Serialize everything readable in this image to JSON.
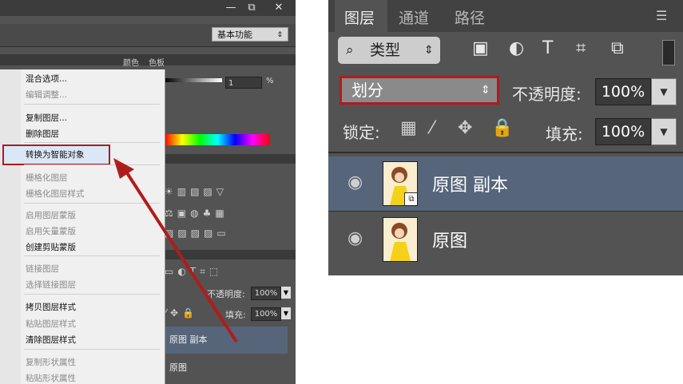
{
  "left_window": {
    "controls": {
      "minimize": "—",
      "maximize": "⧉",
      "close": "✕"
    },
    "workspace": {
      "label": "基本功能"
    },
    "panel_tabs": {
      "color": "颜色",
      "swatches": "色板"
    },
    "opacity_value": "1",
    "percent": "%",
    "layers_panel": {
      "opacity_label": "不透明度:",
      "opacity_value": "100%",
      "fill_label": "填充:",
      "fill_value": "100%",
      "layers": [
        "原图 副本",
        "原图"
      ]
    },
    "context_menu": {
      "items": [
        {
          "label": "混合选项...",
          "enabled": true
        },
        {
          "label": "编辑调整...",
          "enabled": false
        },
        {
          "label": "复制图层...",
          "enabled": true
        },
        {
          "label": "删除图层",
          "enabled": true
        },
        {
          "label": "转换为智能对象",
          "enabled": true,
          "highlighted": true
        },
        {
          "label": "栅格化图层",
          "enabled": false
        },
        {
          "label": "栅格化图层样式",
          "enabled": false
        },
        {
          "label": "启用图层蒙版",
          "enabled": false
        },
        {
          "label": "启用矢量蒙版",
          "enabled": false
        },
        {
          "label": "创建剪贴蒙版",
          "enabled": true
        },
        {
          "label": "链接图层",
          "enabled": false
        },
        {
          "label": "选择链接图层",
          "enabled": false
        },
        {
          "label": "拷贝图层样式",
          "enabled": true
        },
        {
          "label": "粘贴图层样式",
          "enabled": false
        },
        {
          "label": "清除图层样式",
          "enabled": true
        },
        {
          "label": "复制形状属性",
          "enabled": false
        },
        {
          "label": "粘贴形状属性",
          "enabled": false
        }
      ]
    }
  },
  "right_panel": {
    "tabs": [
      "图层",
      "通道",
      "路径"
    ],
    "filter": {
      "label": "类型",
      "search_icon": "search-icon"
    },
    "blend_mode": "划分",
    "opacity_label": "不透明度:",
    "opacity_value": "100%",
    "lock_label": "锁定:",
    "fill_label": "填充:",
    "fill_value": "100%",
    "layers": [
      {
        "name": "原图 副本",
        "selected": true,
        "smart_object": true
      },
      {
        "name": "原图",
        "selected": false,
        "smart_object": false
      }
    ]
  },
  "colors": {
    "highlight_border": "#b21818",
    "selected_layer": "#56657a",
    "arrow": "#b01c1c"
  }
}
